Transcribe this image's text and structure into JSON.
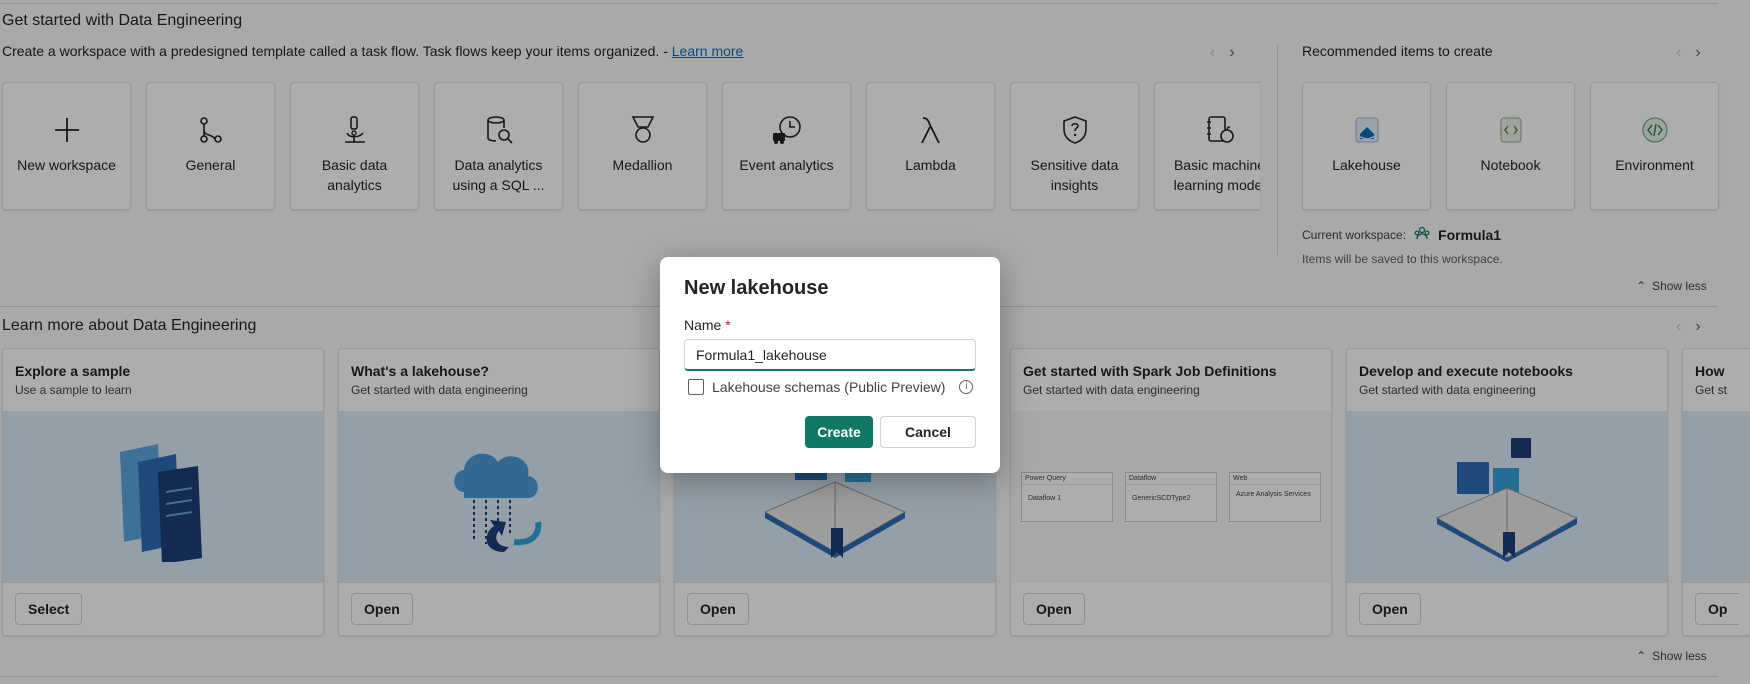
{
  "header": {
    "title": "Get started with Data Engineering",
    "subtitle": "Create a workspace with a predesigned template called a task flow. Task flows keep your items organized. - ",
    "learn_more": "Learn more"
  },
  "task_flows": [
    {
      "label": "New workspace",
      "icon": "plus-icon"
    },
    {
      "label": "General",
      "icon": "branch-icon"
    },
    {
      "label": "Basic data analytics",
      "icon": "microscope-icon"
    },
    {
      "label": "Data analytics using a SQL ...",
      "icon": "database-search-icon"
    },
    {
      "label": "Medallion",
      "icon": "medal-icon"
    },
    {
      "label": "Event analytics",
      "icon": "clock-truck-icon"
    },
    {
      "label": "Lambda",
      "icon": "lambda-icon"
    },
    {
      "label": "Sensitive data insights",
      "icon": "shield-question-icon"
    },
    {
      "label": "Basic machine learning model",
      "icon": "notebook-apple-icon"
    }
  ],
  "recommended": {
    "title": "Recommended items to create",
    "items": [
      {
        "label": "Lakehouse",
        "icon": "lakehouse-icon"
      },
      {
        "label": "Notebook",
        "icon": "notebook-icon"
      },
      {
        "label": "Environment",
        "icon": "environment-icon"
      }
    ],
    "workspace_label": "Current workspace:",
    "workspace_name": "Formula1",
    "saved_note": "Items will be saved to this workspace.",
    "show_less": "Show less"
  },
  "learn": {
    "title": "Learn more about Data Engineering",
    "show_less": "Show less",
    "cards": [
      {
        "title": "Explore a sample",
        "subtitle": "Use a sample to learn",
        "button": "Select",
        "art": "documents-art"
      },
      {
        "title": "What's a lakehouse?",
        "subtitle": "Get started with data engineering",
        "button": "Open",
        "art": "cloud-art"
      },
      {
        "title": "",
        "subtitle": "",
        "button": "Open",
        "art": "book-art"
      },
      {
        "title": "Get started with Spark Job Definitions",
        "subtitle": "Get started with data engineering",
        "button": "Open",
        "art": "pipeline-art"
      },
      {
        "title": "Develop and execute notebooks",
        "subtitle": "Get started with data engineering",
        "button": "Open",
        "art": "book-cubes-art"
      },
      {
        "title": "How",
        "subtitle": "Get st",
        "button": "Op",
        "art": "plain-art"
      }
    ],
    "pipeline": {
      "boxes": [
        "Power Query",
        "Dataflow",
        "Web"
      ],
      "items": [
        "Dataflow 1",
        "GenericSCDType2",
        "Azure Analysis Services"
      ]
    }
  },
  "dialog": {
    "title": "New lakehouse",
    "name_label": "Name",
    "required_mark": "*",
    "name_value": "Formula1_lakehouse",
    "checkbox_label": "Lakehouse schemas (Public Preview)",
    "info_glyph": "i",
    "create": "Create",
    "cancel": "Cancel"
  },
  "colors": {
    "accent": "#117865",
    "link": "#0f6cbd",
    "overlay": "rgba(0,0,0,0.32)"
  }
}
